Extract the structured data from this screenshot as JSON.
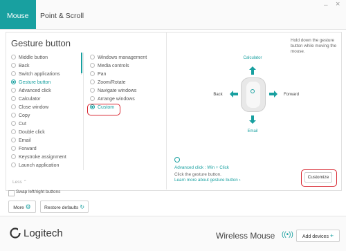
{
  "tabs": {
    "mouse": "Mouse",
    "point_scroll": "Point & Scroll"
  },
  "window_controls": {
    "minimize": "–",
    "close": "×"
  },
  "section_title": "Gesture button",
  "left_column": [
    {
      "label": "Middle button",
      "selected": false
    },
    {
      "label": "Back",
      "selected": false
    },
    {
      "label": "Switch applications",
      "selected": false
    },
    {
      "label": "Gesture button",
      "selected": true
    },
    {
      "label": "Advanced click",
      "selected": false
    },
    {
      "label": "Calculator",
      "selected": false
    },
    {
      "label": "Close window",
      "selected": false
    },
    {
      "label": "Copy",
      "selected": false
    },
    {
      "label": "Cut",
      "selected": false
    },
    {
      "label": "Double click",
      "selected": false
    },
    {
      "label": "Email",
      "selected": false
    },
    {
      "label": "Forward",
      "selected": false
    },
    {
      "label": "Keystroke assignment",
      "selected": false
    },
    {
      "label": "Launch application",
      "selected": false
    }
  ],
  "right_column": [
    {
      "label": "Windows management",
      "selected": false
    },
    {
      "label": "Media controls",
      "selected": false
    },
    {
      "label": "Pan",
      "selected": false
    },
    {
      "label": "Zoom/Rotate",
      "selected": false
    },
    {
      "label": "Navigate windows",
      "selected": false
    },
    {
      "label": "Arrange windows",
      "selected": false
    },
    {
      "label": "Custom",
      "selected": true
    }
  ],
  "less_label": "Less",
  "swap_label": "Swap left/right buttons",
  "more_label": "More",
  "restore_label": "Restore defaults",
  "gesture": {
    "hint": "Hold down the gesture button while moving the mouse.",
    "up": "Calculator",
    "down": "Email",
    "left": "Back",
    "right": "Forward",
    "assignment": "Advanced click : Win + Click",
    "instruction": "Click the gesture button.",
    "learn_more": "Learn more about gesture button",
    "learn_more_arrow": "›",
    "customize_label": "Customize"
  },
  "footer": {
    "brand": "Logitech",
    "device_name": "Wireless Mouse",
    "add_devices": "Add devices",
    "plus": "+"
  },
  "colors": {
    "accent": "#18a0a0",
    "highlight": "#d8252f"
  }
}
